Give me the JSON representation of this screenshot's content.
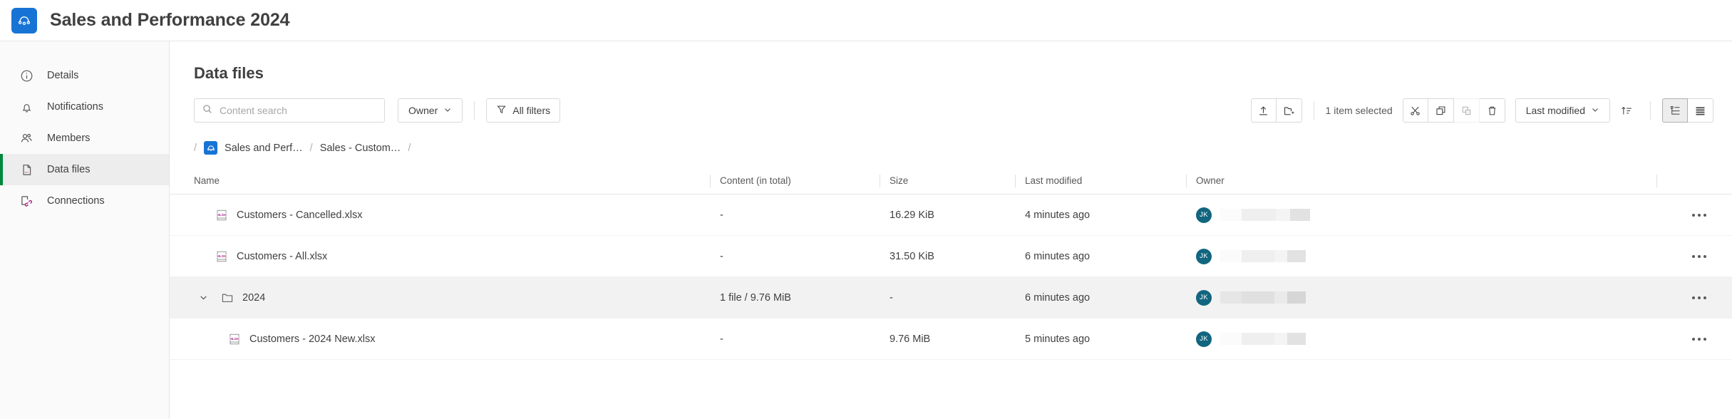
{
  "header": {
    "app_title": "Sales and Performance 2024",
    "logo_icon": "qlik-logo-icon",
    "logo_color": "#1774d4"
  },
  "sidebar": {
    "items": [
      {
        "label": "Details",
        "icon": "info-circle-icon",
        "active": false
      },
      {
        "label": "Notifications",
        "icon": "bell-icon",
        "active": false
      },
      {
        "label": "Members",
        "icon": "people-icon",
        "active": false
      },
      {
        "label": "Data files",
        "icon": "file-icon",
        "active": true
      },
      {
        "label": "Connections",
        "icon": "connection-icon",
        "active": false
      }
    ],
    "active_indicator_color": "#00873d"
  },
  "main": {
    "page_title": "Data files",
    "search": {
      "placeholder": "Content search",
      "value": "",
      "icon": "search-icon"
    },
    "owner_filter": {
      "label": "Owner",
      "icon": "chevron-down-icon"
    },
    "all_filters": {
      "label": "All filters",
      "icon": "funnel-icon"
    },
    "toolbar_right": {
      "upload_label": "upload-icon",
      "new_folder_label": "new-folder-icon",
      "selection_text": "1 item selected",
      "cut_label": "scissors-icon",
      "copy_label": "copy-icon",
      "paste_label": "paste-icon",
      "delete_label": "trash-icon",
      "sort_dropdown": "Last modified",
      "sort_direction_icon": "sort-ascending-icon",
      "tree_view_icon": "tree-view-icon",
      "list_view_icon": "list-view-icon"
    },
    "breadcrumb": {
      "leading_slash": "/",
      "items": [
        {
          "label": "Sales and Perf…",
          "has_logo": true
        },
        {
          "label": "Sales - Custom…",
          "has_logo": false
        }
      ],
      "separator": "/",
      "trailing_slash": "/"
    },
    "table": {
      "columns": [
        "Name",
        "Content (in total)",
        "Size",
        "Last modified",
        "Owner"
      ],
      "rows": [
        {
          "name": "Customers - Cancelled.xlsx",
          "type": "file",
          "icon": "xlsx-file-icon",
          "indent": 1,
          "content": "-",
          "size": "16.29 KiB",
          "last_modified": "4 minutes ago",
          "owner_initials": "JK",
          "selected": false,
          "expanded": null
        },
        {
          "name": "Customers - All.xlsx",
          "type": "file",
          "icon": "xlsx-file-icon",
          "indent": 1,
          "content": "-",
          "size": "31.50 KiB",
          "last_modified": "6 minutes ago",
          "owner_initials": "JK",
          "selected": false,
          "expanded": null
        },
        {
          "name": "2024",
          "type": "folder",
          "icon": "folder-icon",
          "indent": 0,
          "content": "1 file / 9.76 MiB",
          "size": "-",
          "last_modified": "6 minutes ago",
          "owner_initials": "JK",
          "selected": true,
          "expanded": true
        },
        {
          "name": "Customers - 2024 New.xlsx",
          "type": "file",
          "icon": "xlsx-file-icon",
          "indent": 2,
          "content": "-",
          "size": "9.76 MiB",
          "last_modified": "5 minutes ago",
          "owner_initials": "JK",
          "selected": false,
          "expanded": null
        }
      ],
      "row_menu_icon": "more-options-icon",
      "avatar_color": "#11657f",
      "xlsx_icon_color": "#a3177f"
    }
  }
}
